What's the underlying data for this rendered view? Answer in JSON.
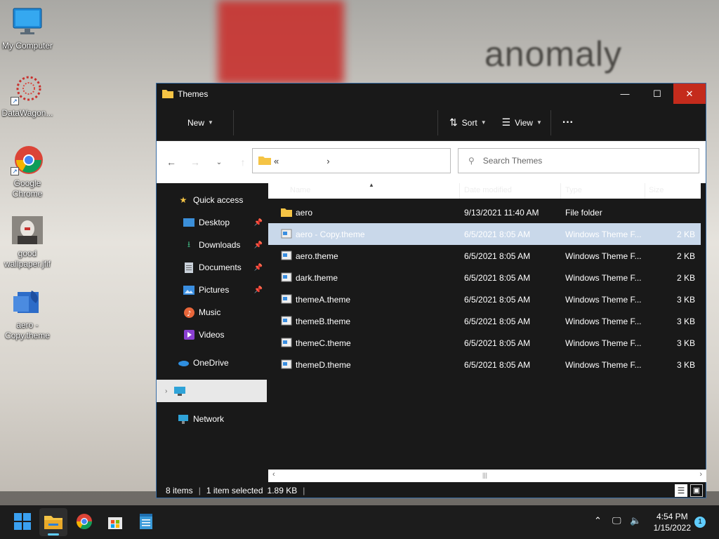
{
  "wallpaper": {
    "text": "anomaly"
  },
  "desktop": {
    "icons": [
      {
        "label": "My Computer"
      },
      {
        "label": "DataWagon..."
      },
      {
        "label": "Google Chrome"
      },
      {
        "label": "good wallpaper.jfif"
      },
      {
        "label": "aero - Copy.theme"
      }
    ]
  },
  "window": {
    "title": "Themes",
    "controls": {
      "minimize": "—",
      "maximize": "☐",
      "close": "✕"
    },
    "toolbar": {
      "new_label": "New",
      "sort_label": "Sort",
      "view_label": "View",
      "more_label": "···"
    },
    "address": {
      "prefix": "«",
      "chevron": "›"
    },
    "search": {
      "placeholder": "Search Themes"
    },
    "nav": {
      "quick_access": "Quick access",
      "items": [
        {
          "label": "Desktop",
          "pinned": true
        },
        {
          "label": "Downloads",
          "pinned": true
        },
        {
          "label": "Documents",
          "pinned": true
        },
        {
          "label": "Pictures",
          "pinned": true
        },
        {
          "label": "Music",
          "pinned": false
        },
        {
          "label": "Videos",
          "pinned": false
        }
      ],
      "onedrive": "OneDrive",
      "this_pc": "This PC",
      "network": "Network"
    },
    "columns": {
      "name": "Name",
      "date": "Date modified",
      "type": "Type",
      "size": "Size"
    },
    "files": [
      {
        "name": "aero",
        "date": "9/13/2021 11:40 AM",
        "type": "File folder",
        "size": "",
        "kind": "folder"
      },
      {
        "name": "aero - Copy.theme",
        "date": "6/5/2021 8:05 AM",
        "type": "Windows Theme F...",
        "size": "2 KB",
        "kind": "theme",
        "selected": true
      },
      {
        "name": "aero.theme",
        "date": "6/5/2021 8:05 AM",
        "type": "Windows Theme F...",
        "size": "2 KB",
        "kind": "theme"
      },
      {
        "name": "dark.theme",
        "date": "6/5/2021 8:05 AM",
        "type": "Windows Theme F...",
        "size": "2 KB",
        "kind": "theme"
      },
      {
        "name": "themeA.theme",
        "date": "6/5/2021 8:05 AM",
        "type": "Windows Theme F...",
        "size": "3 KB",
        "kind": "theme"
      },
      {
        "name": "themeB.theme",
        "date": "6/5/2021 8:05 AM",
        "type": "Windows Theme F...",
        "size": "3 KB",
        "kind": "theme"
      },
      {
        "name": "themeC.theme",
        "date": "6/5/2021 8:05 AM",
        "type": "Windows Theme F...",
        "size": "3 KB",
        "kind": "theme"
      },
      {
        "name": "themeD.theme",
        "date": "6/5/2021 8:05 AM",
        "type": "Windows Theme F...",
        "size": "3 KB",
        "kind": "theme"
      }
    ],
    "status": {
      "items": "8 items",
      "selected": "1 item selected",
      "size": "1.89 KB"
    }
  },
  "taskbar": {
    "clock_time": "4:54 PM",
    "clock_date": "1/15/2022",
    "notification_count": "1"
  },
  "colors": {
    "accent": "#60cdff",
    "close": "#c42b1c",
    "folder": "#f5c445",
    "window_bg": "#191919"
  }
}
